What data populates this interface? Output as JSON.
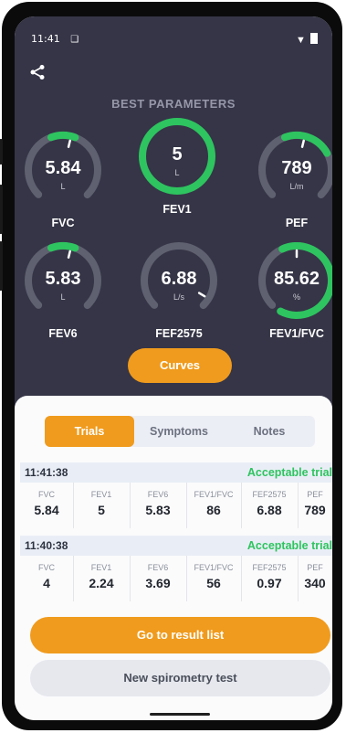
{
  "status_bar": {
    "time": "11:41",
    "sim_icon": "sim-card-icon",
    "right_icons": [
      "wifi-icon",
      "battery-icon"
    ]
  },
  "header": {
    "share_icon": "share-icon",
    "section_title": "BEST PARAMETERS"
  },
  "gauges": [
    {
      "name": "FVC",
      "value": "5.84",
      "unit": "L",
      "fill_fraction": 0.15
    },
    {
      "name": "FEV1",
      "value": "5",
      "unit": "L",
      "fill_fraction": 1.0
    },
    {
      "name": "PEF",
      "value": "789",
      "unit": "L/m",
      "fill_fraction": 0.3
    },
    {
      "name": "FEV6",
      "value": "5.83",
      "unit": "L",
      "fill_fraction": 0.15
    },
    {
      "name": "FEF2575",
      "value": "6.88",
      "unit": "L/s",
      "fill_fraction": 0.0
    },
    {
      "name": "FEV1/FVC",
      "value": "85.62",
      "unit": "%",
      "fill_fraction": 0.86
    }
  ],
  "curves_button": "Curves",
  "tabs": [
    {
      "label": "Trials"
    },
    {
      "label": "Symptoms"
    },
    {
      "label": "Notes"
    }
  ],
  "trials": [
    {
      "time": "11:41:38",
      "status": "Acceptable trial",
      "cells": [
        {
          "label": "FVC",
          "value": "5.84"
        },
        {
          "label": "FEV1",
          "value": "5"
        },
        {
          "label": "FEV6",
          "value": "5.83"
        },
        {
          "label": "FEV1/FVC",
          "value": "86"
        },
        {
          "label": "FEF2575",
          "value": "6.88"
        },
        {
          "label": "PEF",
          "value": "789"
        }
      ]
    },
    {
      "time": "11:40:38",
      "status": "Acceptable trial",
      "cells": [
        {
          "label": "FVC",
          "value": "4"
        },
        {
          "label": "FEV1",
          "value": "2.24"
        },
        {
          "label": "FEV6",
          "value": "3.69"
        },
        {
          "label": "FEV1/FVC",
          "value": "56"
        },
        {
          "label": "FEF2575",
          "value": "0.97"
        },
        {
          "label": "PEF",
          "value": "340"
        }
      ]
    }
  ],
  "buttons": {
    "result_list": "Go to result list",
    "new_test": "New spirometry test"
  },
  "colors": {
    "accent": "#f09b1d",
    "good": "#2ec45f",
    "dark_bg": "#353547",
    "gauge_track": "#5f6070"
  }
}
